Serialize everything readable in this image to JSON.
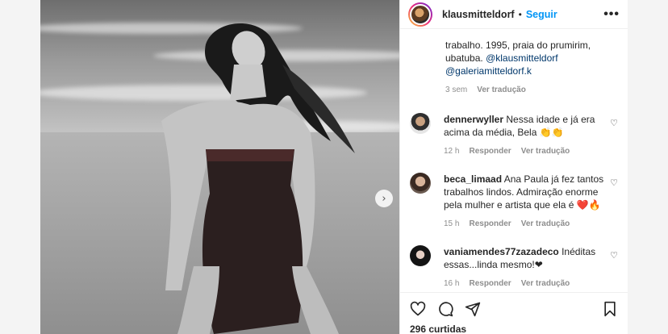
{
  "post": {
    "username": "klausmitteldorf",
    "separator": "•",
    "follow_label": "Seguir",
    "more_label": "•••",
    "next_label": "›"
  },
  "caption": {
    "text": "trabalho. 1995, praia do prumirim, ubatuba.",
    "mention1": "@klausmitteldorf",
    "mention2": "@galeriamitteldorf.k",
    "time": "3 sem",
    "translate": "Ver tradução"
  },
  "comments": [
    {
      "user": "dennerwyller",
      "text": "Nessa idade e já era acima da média, Bela 👏👏",
      "time": "12 h",
      "reply": "Responder",
      "translate": "Ver tradução"
    },
    {
      "user": "beca_limaad",
      "text": "Ana Paula já fez tantos trabalhos lindos. Admiração enorme pela mulher e artista que ela é ❤️🔥",
      "time": "15 h",
      "reply": "Responder",
      "translate": "Ver tradução"
    },
    {
      "user": "vaniamendes77zazadeco",
      "text": "Inéditas essas...linda mesmo!❤",
      "time": "16 h",
      "reply": "Responder",
      "translate": "Ver tradução"
    }
  ],
  "likes": "296 curtidas",
  "icons": {
    "heart": "heart-icon",
    "comment": "comment-icon",
    "share": "share-icon",
    "save": "bookmark-icon",
    "like_small": "♡"
  },
  "colors": {
    "accent": "#0095f6",
    "mention": "#00376b",
    "muted": "#8e8e8e"
  }
}
